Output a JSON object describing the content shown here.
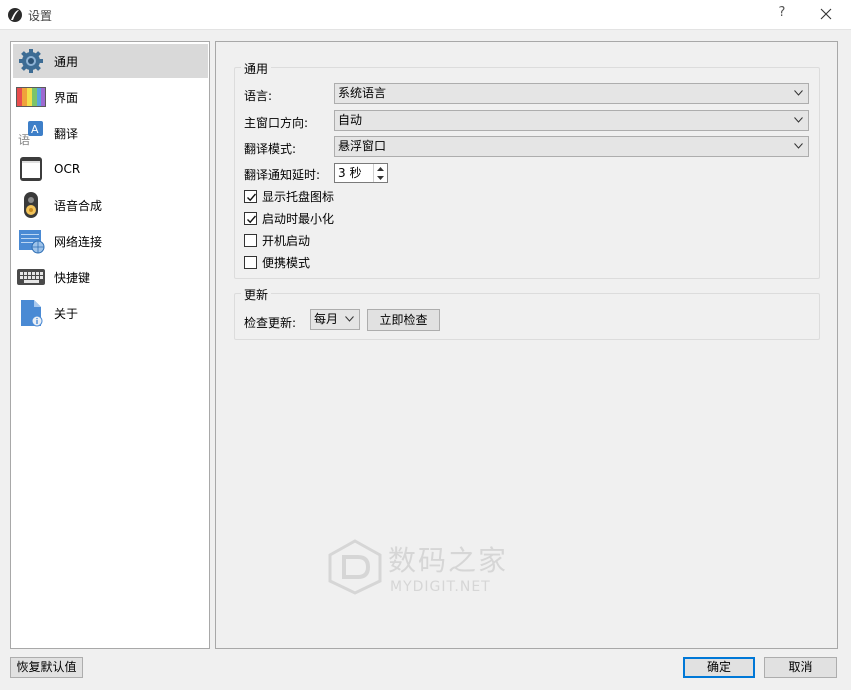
{
  "window": {
    "title": "设置",
    "help": "?"
  },
  "sidebar": {
    "items": [
      {
        "label": "通用",
        "icon": "gear-icon",
        "selected": true
      },
      {
        "label": "界面",
        "icon": "palette-icon",
        "selected": false
      },
      {
        "label": "翻译",
        "icon": "translate-icon",
        "selected": false
      },
      {
        "label": "OCR",
        "icon": "ocr-icon",
        "selected": false
      },
      {
        "label": "语音合成",
        "icon": "speech-icon",
        "selected": false
      },
      {
        "label": "网络连接",
        "icon": "network-icon",
        "selected": false
      },
      {
        "label": "快捷键",
        "icon": "keyboard-icon",
        "selected": false
      },
      {
        "label": "关于",
        "icon": "about-icon",
        "selected": false
      }
    ]
  },
  "general": {
    "group_title": "通用",
    "language_label": "语言:",
    "language_value": "系统语言",
    "window_direction_label": "主窗口方向:",
    "window_direction_value": "自动",
    "translate_mode_label": "翻译模式:",
    "translate_mode_value": "悬浮窗口",
    "notify_delay_label": "翻译通知延时:",
    "notify_delay_value": "3 秒",
    "checkboxes": [
      {
        "label": "显示托盘图标",
        "checked": true
      },
      {
        "label": "启动时最小化",
        "checked": true
      },
      {
        "label": "开机启动",
        "checked": false
      },
      {
        "label": "便携模式",
        "checked": false
      }
    ]
  },
  "update": {
    "group_title": "更新",
    "check_label": "检查更新:",
    "frequency_value": "每月",
    "check_now_button": "立即检查"
  },
  "footer": {
    "reset_button": "恢复默认值",
    "ok_button": "确定",
    "cancel_button": "取消"
  },
  "watermark": {
    "line1": "数码之家",
    "line2": "MYDIGIT.NET"
  }
}
